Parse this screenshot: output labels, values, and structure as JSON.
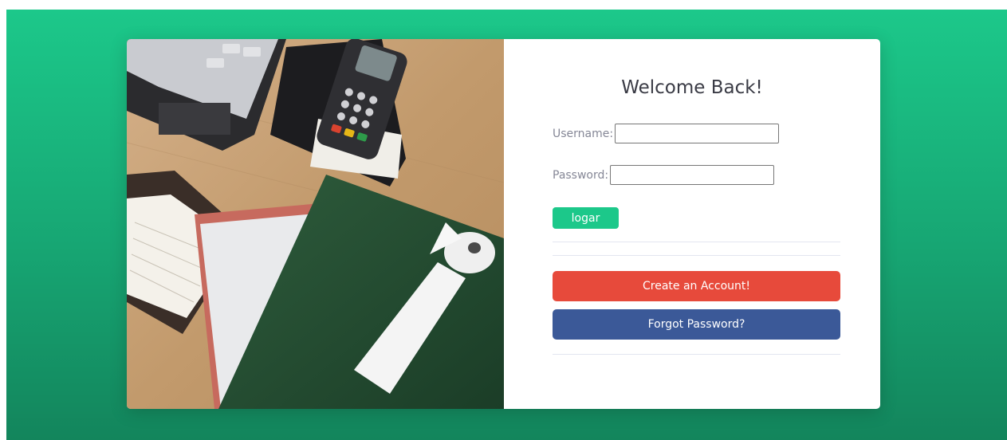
{
  "login": {
    "title": "Welcome Back!",
    "username_label": "Username:",
    "username_value": "",
    "password_label": "Password:",
    "password_value": "",
    "submit_label": "logar",
    "create_account_label": "Create an Account!",
    "forgot_password_label": "Forgot Password?"
  },
  "colors": {
    "background_gradient_top": "#1cc88a",
    "background_gradient_bottom": "#13855c",
    "submit_button": "#1cc88a",
    "create_account_button": "#e74a3b",
    "forgot_password_button": "#3b5998"
  },
  "image": {
    "subject": "desk-with-laptop-card-terminal-notebooks-receipt-roll"
  }
}
